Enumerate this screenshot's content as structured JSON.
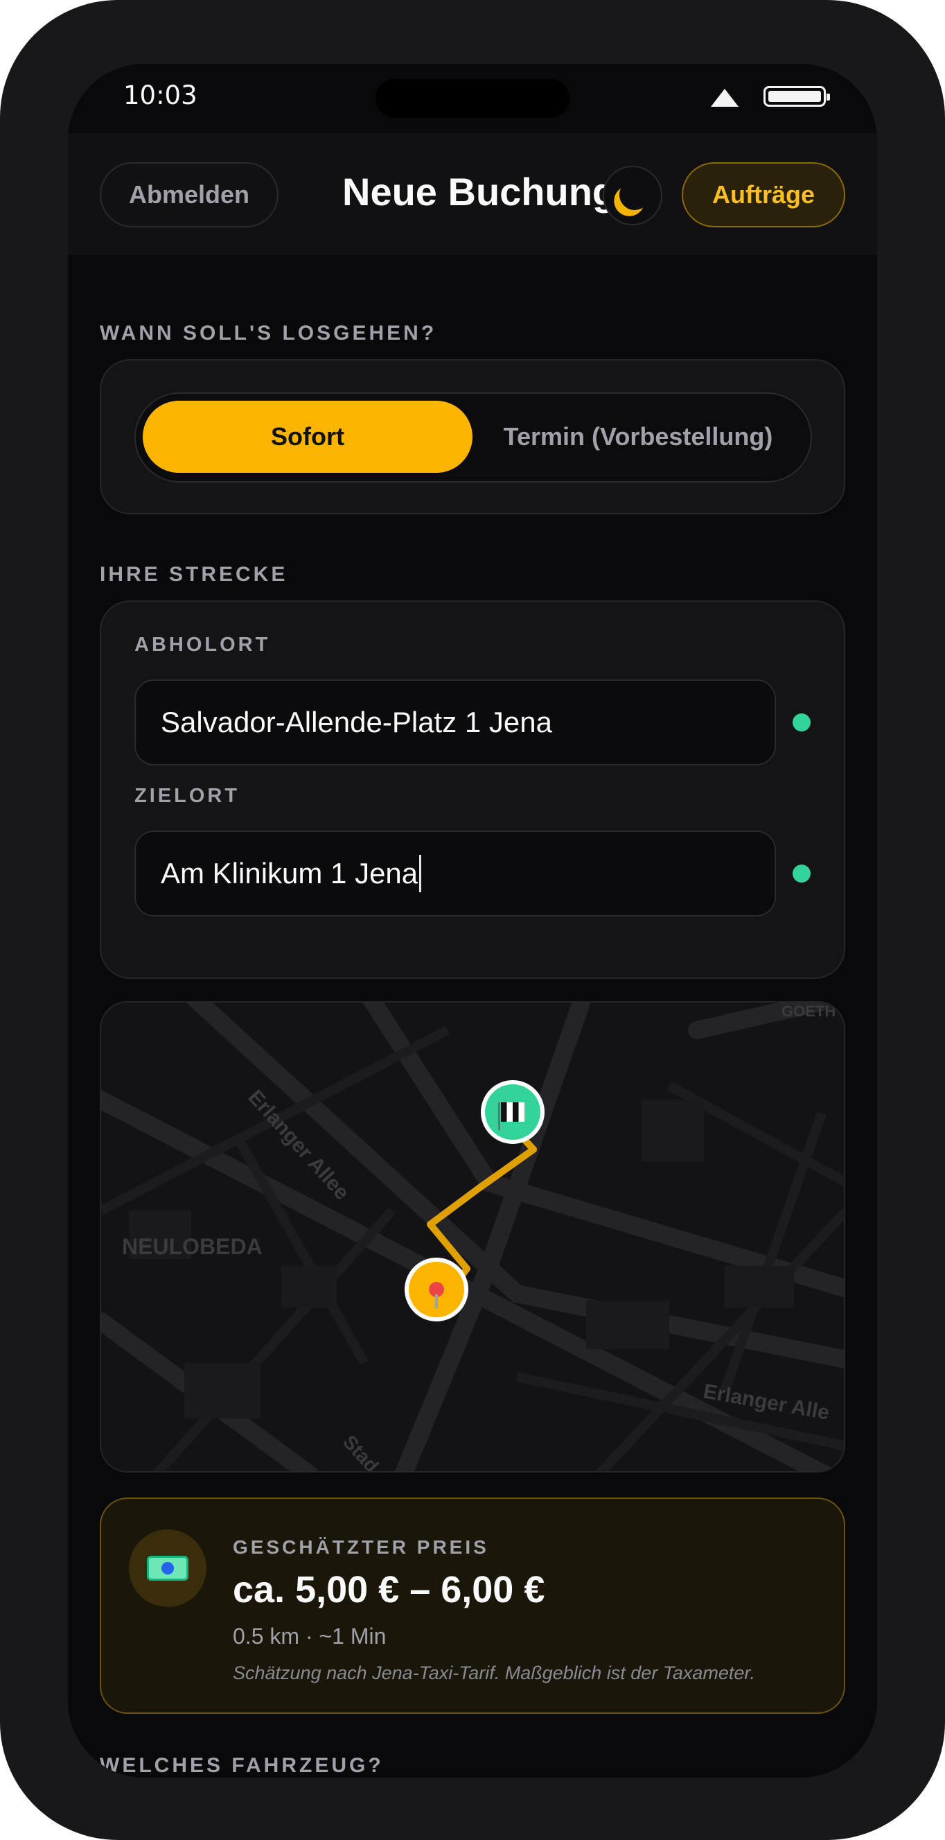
{
  "status_bar": {
    "time": "10:03"
  },
  "header": {
    "logout_label": "Abmelden",
    "title": "Neue Buchung",
    "theme_icon": "moon-icon",
    "orders_label": "Aufträge"
  },
  "when": {
    "section_label": "WANN SOLL'S LOSGEHEN?",
    "options": [
      "Sofort",
      "Termin (Vorbestellung)"
    ],
    "selected": "Sofort"
  },
  "route": {
    "section_label": "IHRE STRECKE",
    "pickup_label": "ABHOLORT",
    "pickup_value": "Salvador-Allende-Platz 1 Jena",
    "destination_label": "ZIELORT",
    "destination_value": "Am Klinikum 1 Jena",
    "status_color": "#34d399"
  },
  "map": {
    "labels": [
      "NEULOBEDA",
      "Erlanger Allee",
      "Erlanger Alle",
      "GOETH",
      "Stad"
    ],
    "route_color": "#f5b400",
    "start_icon": "pin-icon",
    "destination_icon": "checkered-flag-icon"
  },
  "price": {
    "label": "GESCHÄTZTER PREIS",
    "value": "ca. 5,00 € – 6,00 €",
    "meta": "0.5 km · ~1 Min",
    "note": "Schätzung nach Jena-Taxi-Tarif. Maßgeblich ist der Taxameter.",
    "icon": "money-icon"
  },
  "vehicle": {
    "section_label": "WELCHES FAHRZEUG?"
  },
  "colors": {
    "accent": "#fbb500",
    "background": "#09090b",
    "success": "#34d399"
  }
}
